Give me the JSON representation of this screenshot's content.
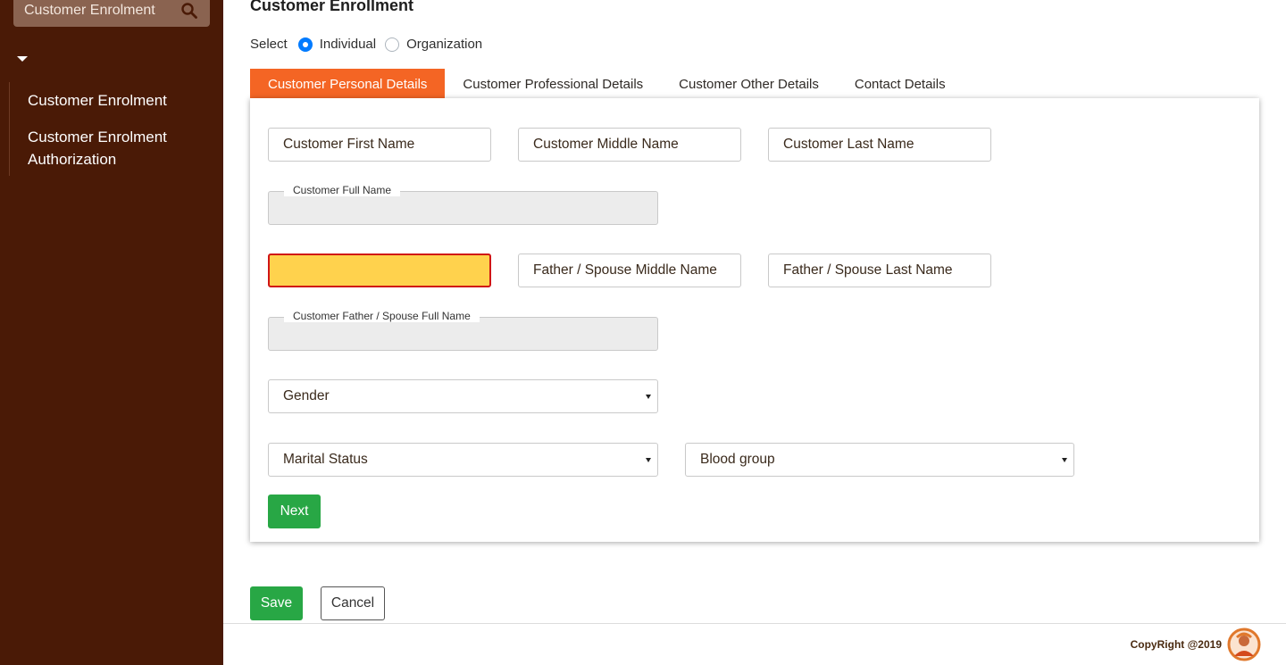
{
  "sidebar": {
    "search_text": "Customer Enrolment",
    "search_icon": "search-icon",
    "menu_items": [
      {
        "label": "Customer Enrolment"
      },
      {
        "label": "Customer Enrolment Authorization"
      }
    ]
  },
  "page": {
    "title": "Customer Enrollment",
    "select_label": "Select",
    "options": [
      {
        "label": "Individual",
        "checked": true
      },
      {
        "label": "Organization",
        "checked": false
      }
    ]
  },
  "tabs": [
    {
      "label": "Customer Personal Details",
      "active": true
    },
    {
      "label": "Customer Professional Details",
      "active": false
    },
    {
      "label": "Customer Other Details",
      "active": false
    },
    {
      "label": "Contact Details",
      "active": false
    }
  ],
  "form": {
    "first_name_placeholder": "Customer First Name",
    "middle_name_placeholder": "Customer Middle Name",
    "last_name_placeholder": "Customer Last Name",
    "full_name_label": "Customer Full Name",
    "full_name_value": "",
    "father_first_value": "",
    "father_middle_placeholder": "Father / Spouse Middle Name",
    "father_last_placeholder": "Father / Spouse Last Name",
    "father_full_label": "Customer Father / Spouse Full Name",
    "father_full_value": "",
    "gender": "Gender",
    "marital_status": "Marital Status",
    "blood_group": "Blood group",
    "next_label": "Next"
  },
  "actions": {
    "save_label": "Save",
    "cancel_label": "Cancel"
  },
  "footer": {
    "copyright": "CopyRight @2019"
  },
  "colors": {
    "sidebar_bg": "#4a1a06",
    "tab_active": "#f46524",
    "button_green": "#28a745",
    "error_fill": "#ffd24d",
    "error_border": "#d01515",
    "radio_checked": "#007bff"
  }
}
